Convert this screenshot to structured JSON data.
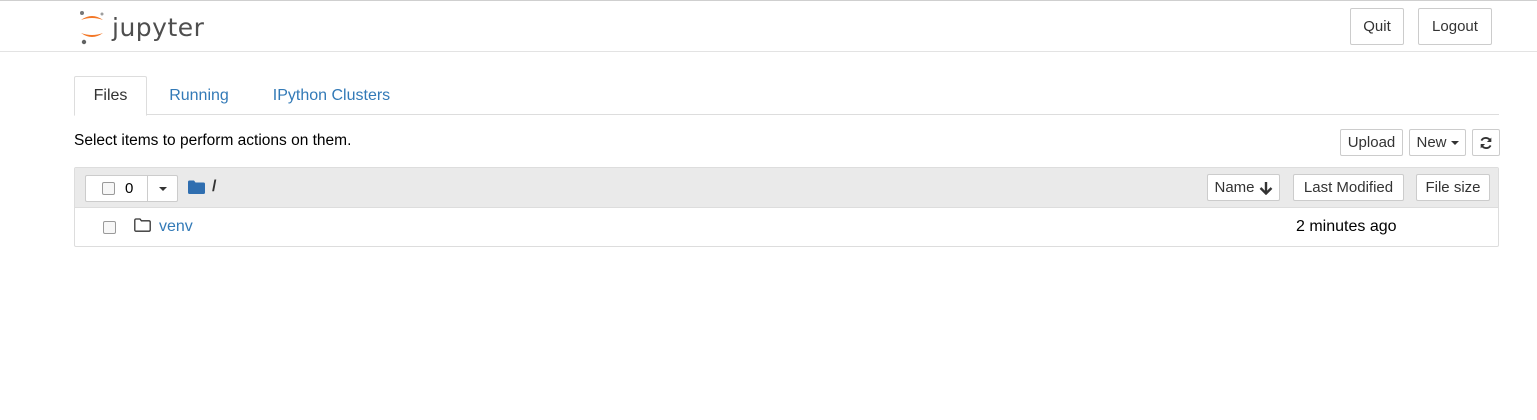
{
  "header": {
    "logo_text": "jupyter",
    "quit_label": "Quit",
    "logout_label": "Logout"
  },
  "tabs": [
    {
      "label": "Files",
      "active": true
    },
    {
      "label": "Running",
      "active": false
    },
    {
      "label": "IPython Clusters",
      "active": false
    }
  ],
  "toolbar": {
    "hint": "Select items to perform actions on them.",
    "upload_label": "Upload",
    "new_label": "New",
    "refresh_icon": "refresh-icon"
  },
  "list_header": {
    "selected_count": "0",
    "breadcrumb": "/",
    "sort_name_label": "Name",
    "sort_modified_label": "Last Modified",
    "sort_size_label": "File size"
  },
  "items": [
    {
      "name": "venv",
      "type": "folder",
      "modified": "2 minutes ago"
    }
  ],
  "colors": {
    "link": "#337ab7",
    "logo_orange": "#f37726",
    "folder_blue": "#2f6eb0"
  }
}
